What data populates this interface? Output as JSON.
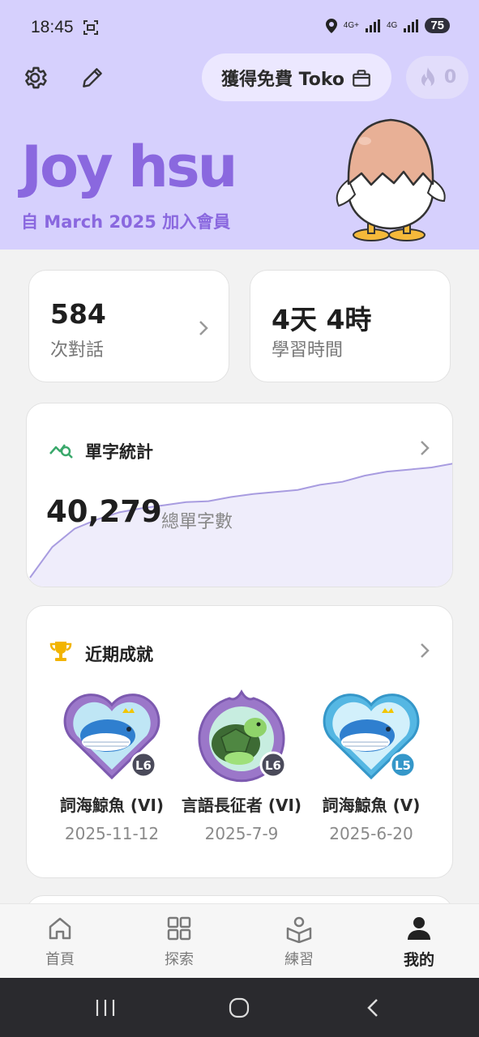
{
  "status_bar": {
    "time": "18:45",
    "network_1": "4G+",
    "network_2": "4G",
    "battery": "75"
  },
  "header": {
    "settings_icon": "gear-icon",
    "edit_icon": "pencil-icon",
    "toko_label": "獲得免費 Toko",
    "streak_count": "0",
    "username": "Joy hsu",
    "member_since": "自 March 2025 加入會員",
    "colors": {
      "background": "#d6d0fd",
      "accent": "#8a68df"
    }
  },
  "stats": {
    "conversations": {
      "value": "584",
      "label": "次對話"
    },
    "learning_time": {
      "value": "4天 4時",
      "label": "學習時間"
    }
  },
  "vocab": {
    "title": "單字統計",
    "total": "40,279",
    "total_label": "總單字數",
    "chart_data": {
      "type": "area",
      "values": [
        0,
        30,
        48,
        57,
        64,
        68,
        71,
        74,
        75,
        79,
        82,
        84,
        86,
        91,
        94,
        100,
        104,
        106,
        108,
        112
      ],
      "color": "#a89ce0"
    }
  },
  "achievements": {
    "title": "近期成就",
    "items": [
      {
        "name": "詞海鯨魚 (VI)",
        "date": "2025-11-12",
        "level": "L6",
        "type": "whale"
      },
      {
        "name": "言語長征者 (VI)",
        "date": "2025-7-9",
        "level": "L6",
        "type": "turtle"
      },
      {
        "name": "詞海鯨魚 (V)",
        "date": "2025-6-20",
        "level": "L5",
        "type": "whale"
      }
    ]
  },
  "nav": {
    "items": [
      {
        "label": "首頁",
        "icon": "home-icon"
      },
      {
        "label": "探索",
        "icon": "grid-icon"
      },
      {
        "label": "練習",
        "icon": "book-person-icon"
      },
      {
        "label": "我的",
        "icon": "person-icon"
      }
    ],
    "active": "我的"
  }
}
